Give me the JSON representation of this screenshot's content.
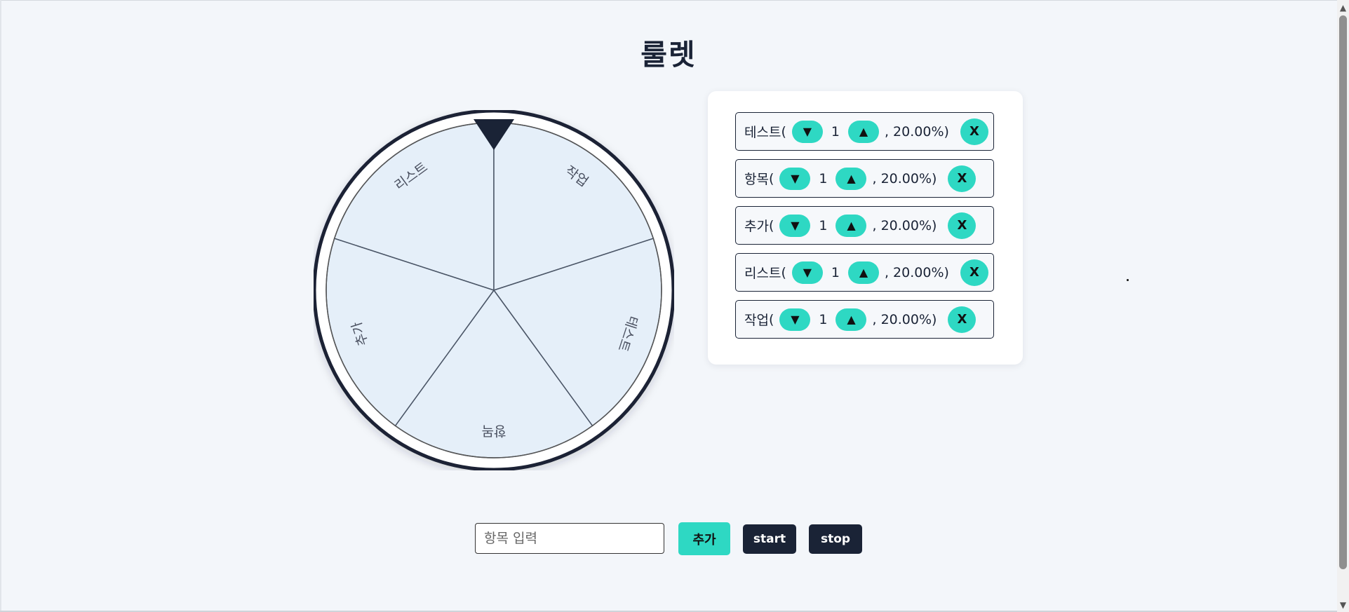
{
  "title": "룰렛",
  "wheel": {
    "segments": [
      "리스트",
      "작업",
      "테스트",
      "항목",
      "추가"
    ]
  },
  "items": [
    {
      "name": "테스트",
      "count": "1",
      "percent": ", 20.00%)"
    },
    {
      "name": "항목",
      "count": "1",
      "percent": ", 20.00%)"
    },
    {
      "name": "추가",
      "count": "1",
      "percent": ", 20.00%)"
    },
    {
      "name": "리스트",
      "count": "1",
      "percent": ", 20.00%)"
    },
    {
      "name": "작업",
      "count": "1",
      "percent": ", 20.00%)"
    }
  ],
  "labels": {
    "open_paren": " (",
    "down_arrow": "▼",
    "up_arrow": "▲",
    "remove": "X"
  },
  "input": {
    "placeholder": "항목 입력"
  },
  "buttons": {
    "add": "추가",
    "start": "start",
    "stop": "stop"
  }
}
